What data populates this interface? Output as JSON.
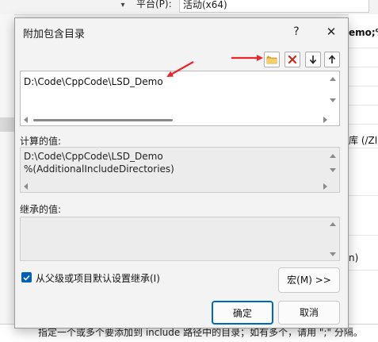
{
  "background": {
    "platform_label": "平台(P):",
    "platform_value": "活动(x64)",
    "right_fragments": [
      "emo;%",
      "库 (/ZI)",
      "n)"
    ],
    "bottom_text": "指定一个或多个要添加到 include 路径中的目录；如有多个，请用 \";\" 分隔。"
  },
  "dialog": {
    "title": "附加包含目录",
    "help_label": "?",
    "close_label": "✕",
    "toolbar": {
      "new_folder_icon": "new-folder-icon",
      "delete_icon": "delete-icon",
      "move_down_icon": "move-down-icon",
      "move_up_icon": "move-up-icon"
    },
    "edit_lines": [
      "D:\\Code\\CppCode\\LSD_Demo"
    ],
    "computed_label": "计算的值:",
    "computed_lines": [
      "D:\\Code\\CppCode\\LSD_Demo",
      "%(AdditionalIncludeDirectories)"
    ],
    "inherited_label": "继承的值:",
    "inherit_checkbox_label": "从父级或项目默认设置继承(I)",
    "inherit_checked": true,
    "macro_button": "宏(M) >>",
    "ok_button": "确定",
    "cancel_button": "取消"
  },
  "colors": {
    "accent": "#0067c0",
    "annotation_arrow": "#e8262b",
    "delete_x": "#c42b1c"
  }
}
